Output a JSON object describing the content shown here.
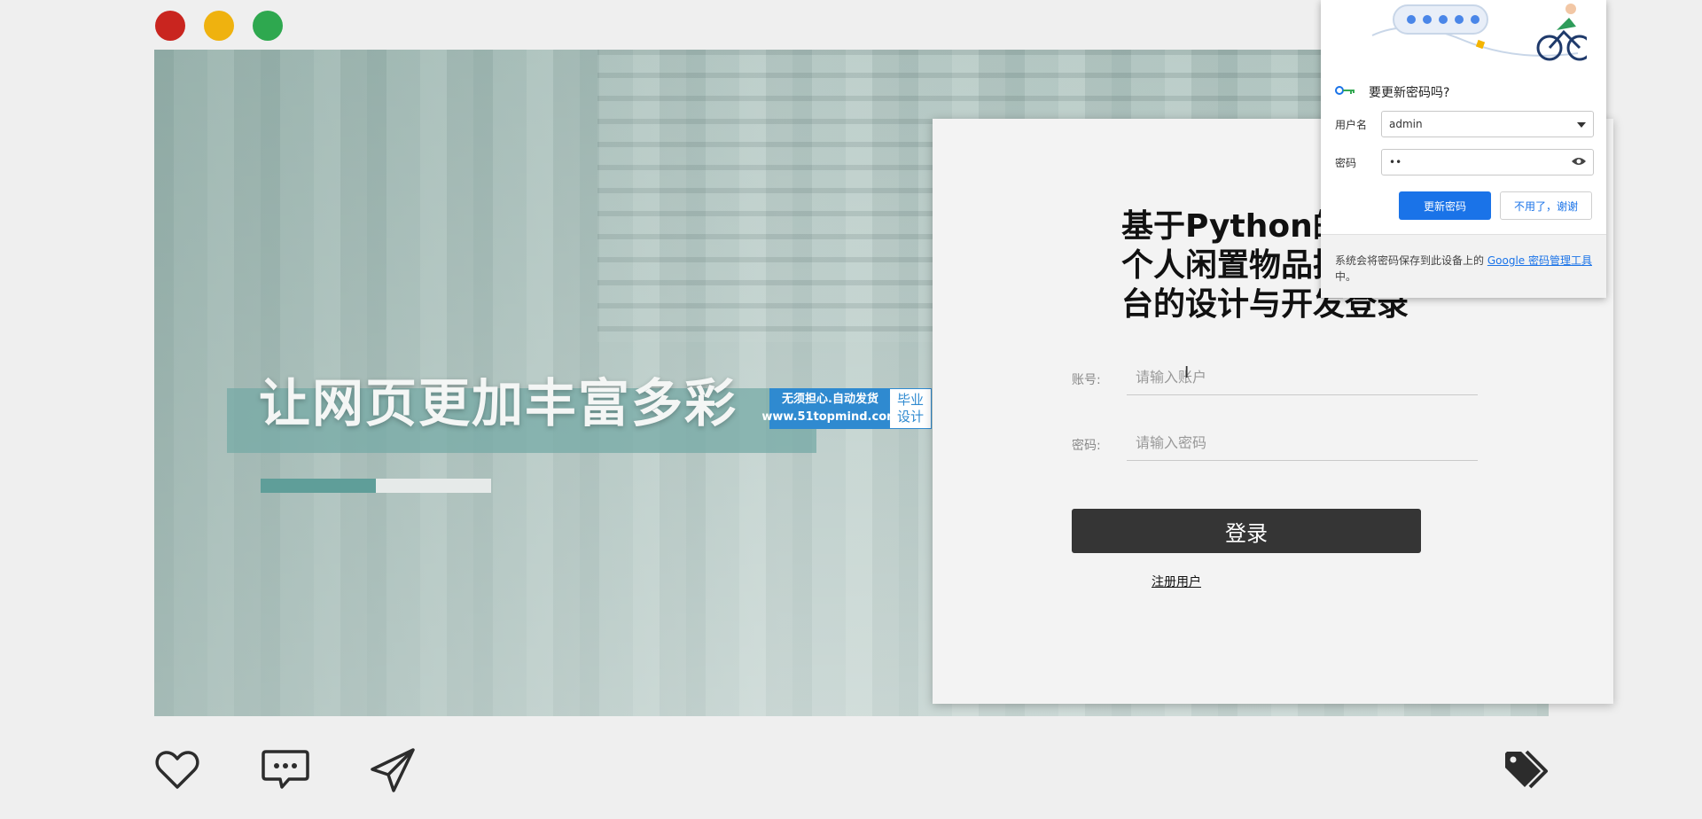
{
  "window_controls": {
    "close_color": "#c9251f",
    "minimize_color": "#efb20f",
    "maximize_color": "#2ea84f"
  },
  "hero": {
    "slogan": "让网页更加丰富多彩",
    "progress": 0.5,
    "badge": {
      "line1": "无须担心.自动发货",
      "line2": "www.51topmind.com",
      "side_line1": "毕业",
      "side_line2": "设计"
    }
  },
  "login": {
    "title": "基于Python的个人闲置物品换台的设计与开发登录",
    "title_lines": [
      "基于Python的",
      "个人闲置物品换",
      "台的设计与开发登录"
    ],
    "account_label": "账号:",
    "account_placeholder": "请输入账户",
    "password_label": "密码:",
    "password_placeholder": "请输入密码",
    "submit_label": "登录",
    "register_link": "注册用户"
  },
  "password_popup": {
    "title": "要更新密码吗?",
    "username_label": "用户名",
    "username_value": "admin",
    "password_label": "密码",
    "password_value": "••",
    "update_button": "更新密码",
    "cancel_button": "不用了，谢谢",
    "footer_text": "系统会将密码保存到此设备上的",
    "footer_link": "Google 密码管理工具",
    "footer_suffix": "中。"
  },
  "bottom_icons": [
    "heart-icon",
    "comment-icon",
    "send-icon",
    "tag-icon"
  ]
}
